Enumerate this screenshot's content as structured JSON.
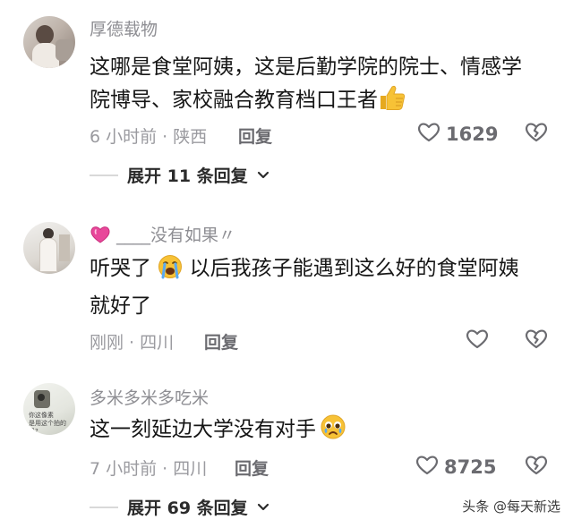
{
  "comments": [
    {
      "username": "厚德载物",
      "text_line1": "这哪是食堂阿姨，这是后勤学院的院士、情感学",
      "text_line2": "院博导、家校融合教育档口王者",
      "time": "6 小时前 · 陕西",
      "reply": "回复",
      "likes": "1629",
      "expand": "展开 11 条回复"
    },
    {
      "username": "____没有如果〃",
      "text_part1": "听哭了",
      "text_part2": "以后我孩子能遇到这么好的食堂阿姨",
      "text_line2": "就好了",
      "time": "刚刚 · 四川",
      "reply": "回复"
    },
    {
      "username": "多米多米多吃米",
      "text": "这一刻延边大学没有对手",
      "time": "7 小时前 · 四川",
      "reply": "回复",
      "likes": "8725",
      "expand": "展开 69 条回复"
    }
  ],
  "icons": {
    "like": "heart-outline-icon",
    "dislike": "broken-heart-icon",
    "chevron": "chevron-down-icon",
    "thumbs_up": "thumbs-up-emoji",
    "crying": "loudly-crying-emoji",
    "pleading": "pleading-tears-emoji",
    "pink_heart": "sparkling-heart-emoji"
  },
  "avatar3_overlay": {
    "line1": "你这像素",
    "line2": "是用这个拍的吗?"
  },
  "watermark": "头条 @每天新选",
  "colors": {
    "text": "#161616",
    "meta": "#9a9a9f",
    "emoji_yellow": "#f7c236",
    "pink": "#e8479a"
  }
}
